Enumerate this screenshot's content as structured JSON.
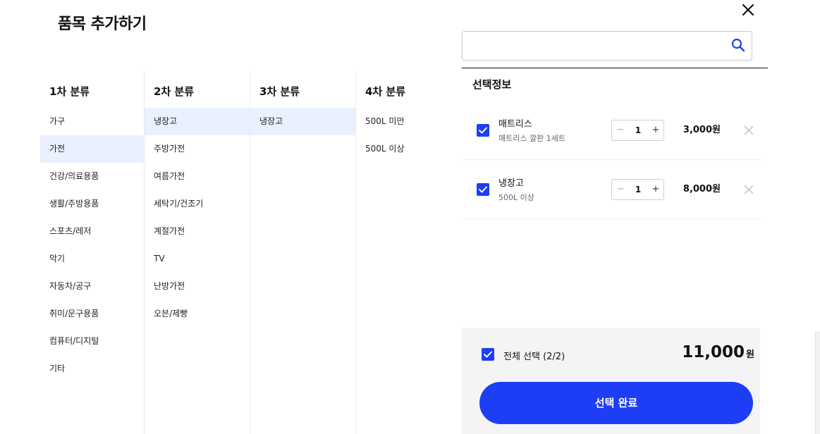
{
  "modal": {
    "title": "품목 추가하기",
    "close_icon": "close-icon"
  },
  "search": {
    "value": "",
    "placeholder": "",
    "icon": "search-icon"
  },
  "categories": {
    "col1": {
      "header": "1차 분류",
      "selected": "가전",
      "items": [
        "가구",
        "가전",
        "건강/의료용품",
        "생활/주방용품",
        "스포츠/레저",
        "악기",
        "자동차/공구",
        "취미/문구용품",
        "컴퓨터/디지털",
        "기타"
      ]
    },
    "col2": {
      "header": "2차 분류",
      "selected": "냉장고",
      "items": [
        "냉장고",
        "주방가전",
        "여름가전",
        "세탁기/건조기",
        "계절가전",
        "TV",
        "난방가전",
        "오븐/제빵"
      ]
    },
    "col3": {
      "header": "3차 분류",
      "selected": "냉장고",
      "items": [
        "냉장고"
      ]
    },
    "col4": {
      "header": "4차 분류",
      "items": [
        "500L 미만",
        "500L 이상"
      ]
    }
  },
  "selection": {
    "title": "선택정보",
    "items": [
      {
        "name": "매트리스",
        "sub": "매트리스 깔판 1세트",
        "qty": "1",
        "price": "3,000원",
        "checked": true,
        "minus": "−",
        "plus": "+"
      },
      {
        "name": "냉장고",
        "sub": "500L 이상",
        "qty": "1",
        "price": "8,000원",
        "checked": true,
        "minus": "−",
        "plus": "+"
      }
    ]
  },
  "footer": {
    "select_all_label": "전체 선택 (2/2)",
    "total_amount": "11,000",
    "total_unit": "원",
    "confirm_label": "선택 완료"
  },
  "colors": {
    "accent": "#1d3ef5",
    "selected_bg": "#eaf0fd",
    "footer_bg": "#f4f4f4"
  }
}
